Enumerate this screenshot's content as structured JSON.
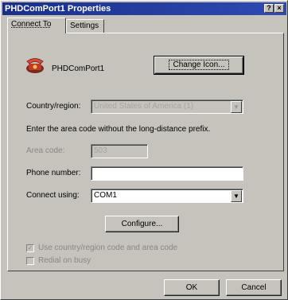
{
  "window": {
    "title": "PHDComPort1 Properties",
    "help_glyph": "?",
    "close_glyph": "×"
  },
  "tabs": [
    {
      "label": "Connect To",
      "active": true
    },
    {
      "label": "Settings",
      "active": false
    }
  ],
  "device": {
    "name": "PHDComPort1",
    "icon": "modem-phone-icon"
  },
  "change_icon_label": "Change Icon...",
  "country": {
    "label": "Country/region:",
    "value": "United States of America (1)"
  },
  "instructions": "Enter the area code without the long-distance prefix.",
  "area_code": {
    "label": "Area code:",
    "value": "503"
  },
  "phone_number": {
    "label": "Phone number:",
    "value": ""
  },
  "connect_using": {
    "label": "Connect using:",
    "value": "COM1"
  },
  "configure_label": "Configure...",
  "checkboxes": {
    "use_country": {
      "label": "Use country/region code and area code",
      "checked": true
    },
    "redial": {
      "label": "Redial on busy",
      "checked": false
    }
  },
  "footer": {
    "ok_label": "OK",
    "cancel_label": "Cancel"
  }
}
